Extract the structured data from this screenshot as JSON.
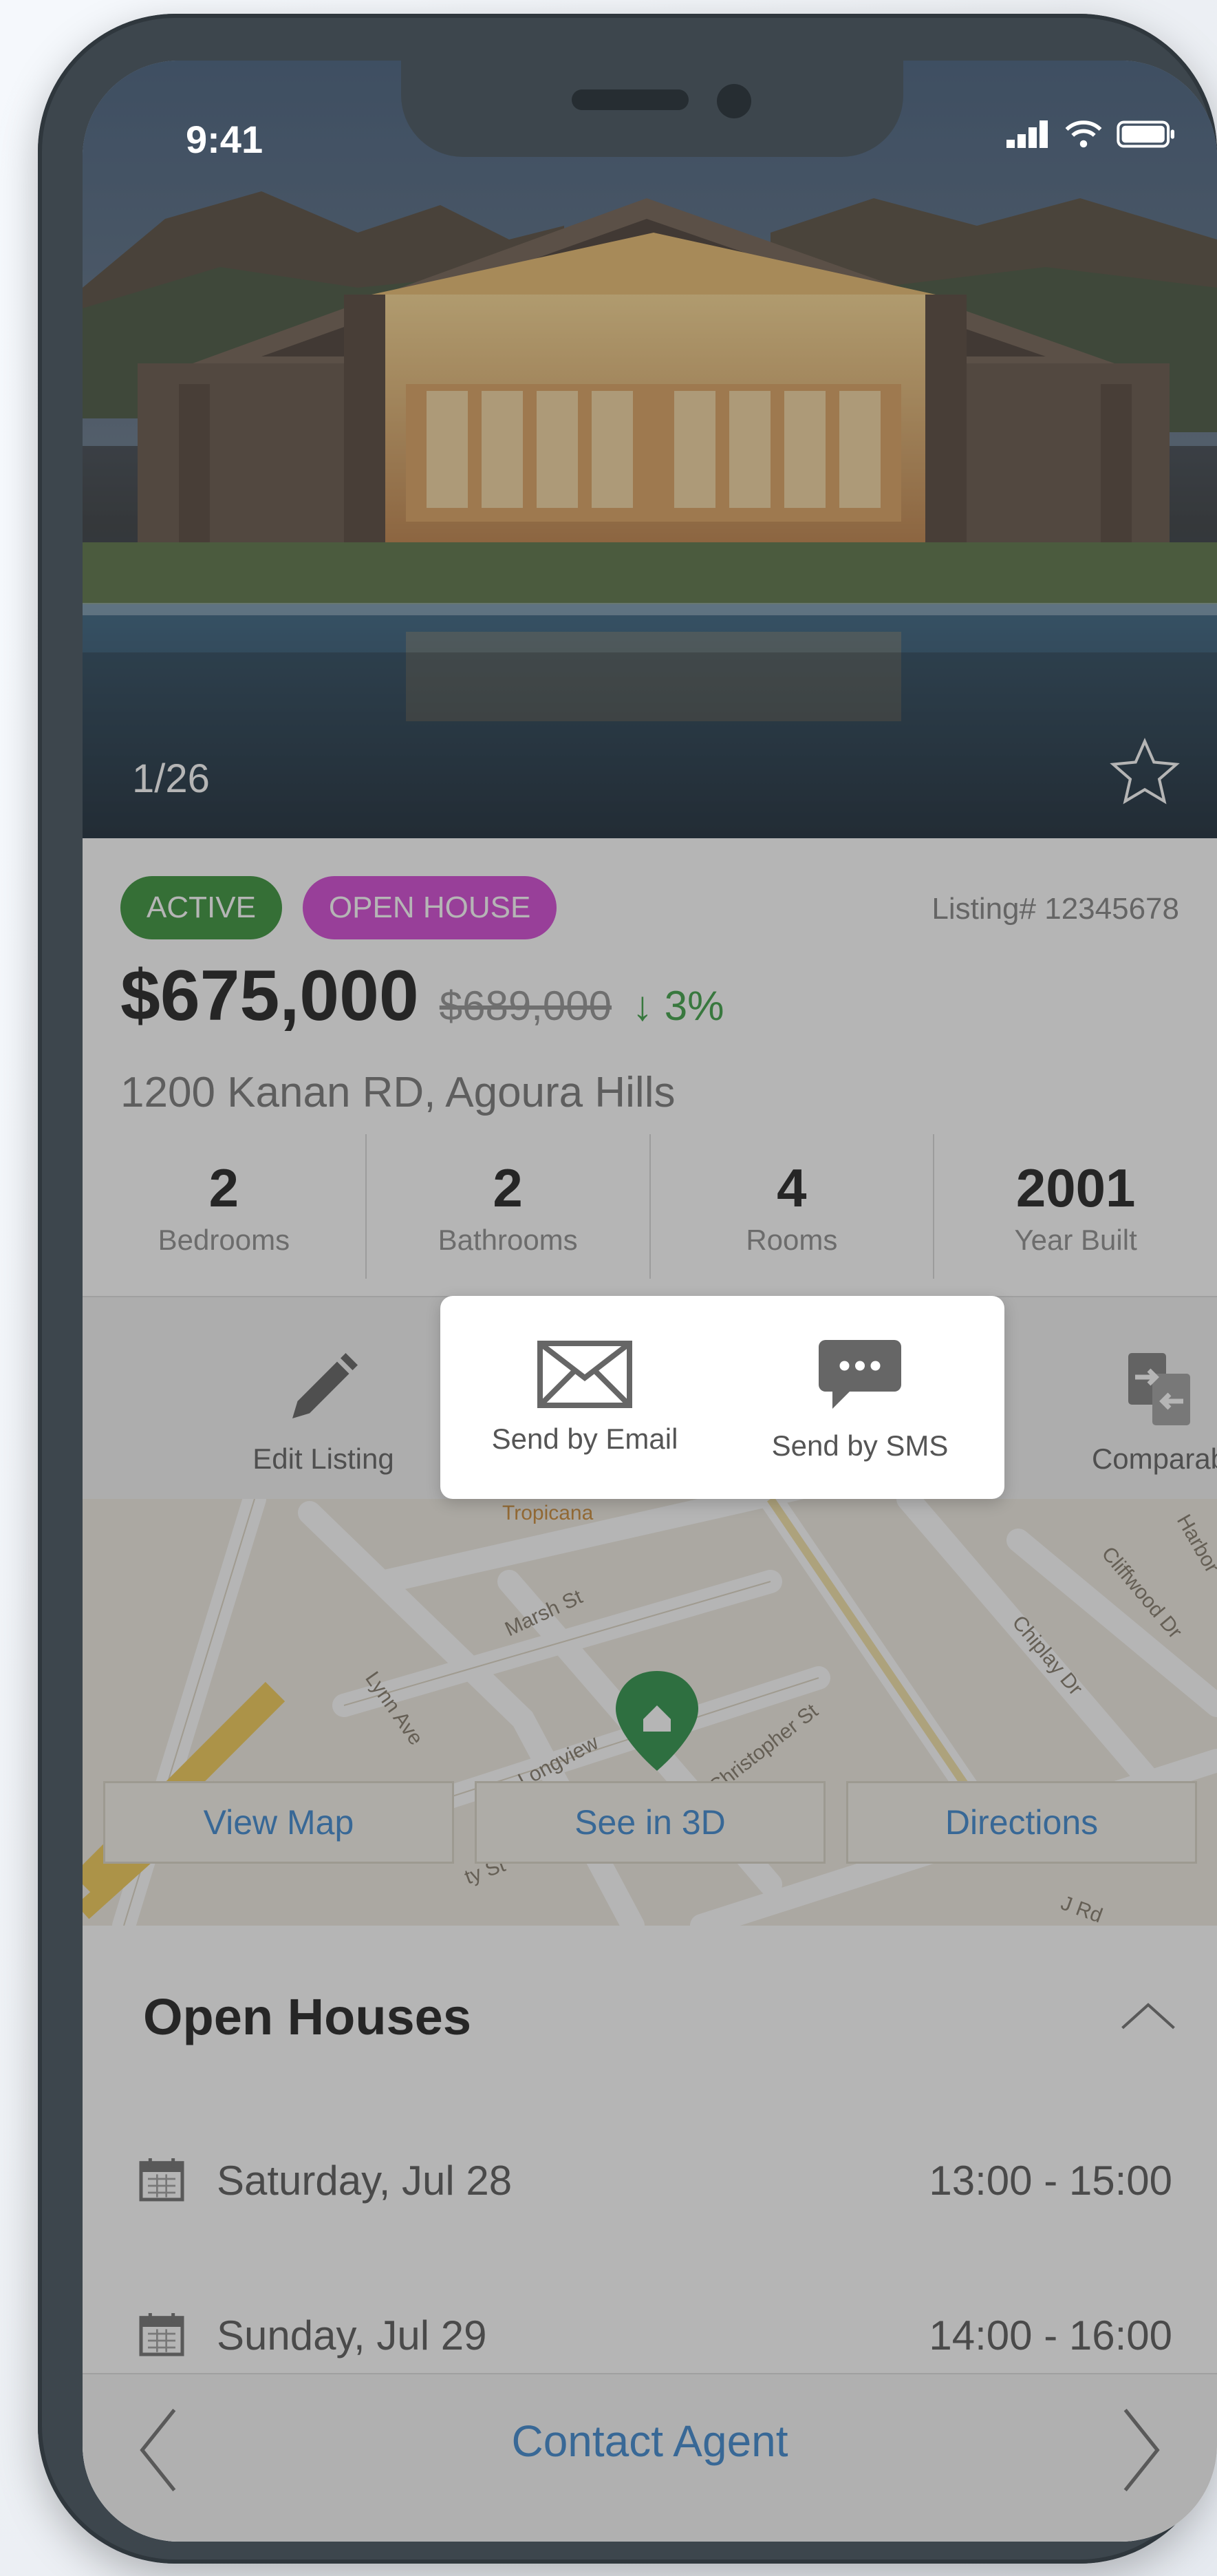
{
  "status_bar": {
    "time": "9:41"
  },
  "gallery": {
    "counter": "1/26"
  },
  "listing": {
    "badges": {
      "active": "ACTIVE",
      "open_house": "OPEN HOUSE"
    },
    "listing_number": "Listing# 12345678",
    "price": "$675,000",
    "old_price": "$689,000",
    "price_change": "↓ 3%",
    "address": "1200 Kanan RD, Agoura Hills"
  },
  "stats": [
    {
      "value": "2",
      "label": "Bedrooms"
    },
    {
      "value": "2",
      "label": "Bathrooms"
    },
    {
      "value": "4",
      "label": "Rooms"
    },
    {
      "value": "2001",
      "label": "Year Built"
    }
  ],
  "actions": {
    "edit": "Edit Listing",
    "email": "Send by Email",
    "sms": "Send by SMS",
    "compare": "Comparab"
  },
  "map": {
    "streets": [
      "Marsh St",
      "Lynn Ave",
      "Longview",
      "Christopher St",
      "Chiplay Dr",
      "Cliffwood Dr",
      "Harbor",
      "ty St",
      "Tropicana",
      "J Rd"
    ],
    "buttons": {
      "view_map": "View Map",
      "see_3d": "See in 3D",
      "directions": "Directions"
    }
  },
  "open_houses": {
    "title": "Open Houses",
    "items": [
      {
        "day": "Saturday, Jul 28",
        "time": "13:00 - 15:00"
      },
      {
        "day": "Sunday, Jul 29",
        "time": "14:00 - 16:00"
      }
    ]
  },
  "bottom_bar": {
    "contact": "Contact Agent"
  },
  "colors": {
    "active_badge": "#2a8a2c",
    "open_house_badge": "#cf3bd0",
    "link_blue": "#2f7fcc",
    "price_drop_green": "#2f9a3a",
    "map_pin_green": "#1f8a3c"
  },
  "icons": [
    "signal-icon",
    "wifi-icon",
    "battery-icon",
    "star-icon",
    "pencil-icon",
    "envelope-icon",
    "chat-bubble-icon",
    "compare-icon",
    "map-pin-icon",
    "chevron-up-icon",
    "calendar-icon",
    "chevron-left-icon",
    "chevron-right-icon"
  ]
}
